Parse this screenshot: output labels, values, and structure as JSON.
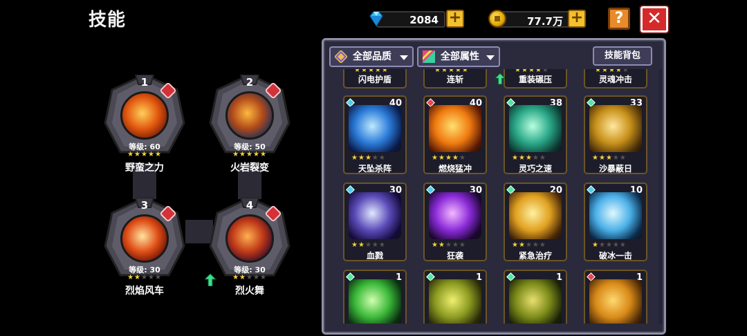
{
  "page": {
    "title": "技能"
  },
  "currency": {
    "gems": {
      "value": "2084",
      "icon": "diamond-gem-icon"
    },
    "gold": {
      "value": "77.7万",
      "icon": "gold-coin-icon"
    },
    "plus_label": "+"
  },
  "buttons": {
    "help_label": "?",
    "close_label": "✕"
  },
  "equipped": [
    {
      "slot": "1",
      "level": "等级: 60",
      "stars": 5,
      "name": "野蛮之力",
      "colors": [
        "#ffcf5a",
        "#e35a10",
        "#7a1a08"
      ]
    },
    {
      "slot": "2",
      "level": "等级: 50",
      "stars": 5,
      "name": "火岩裂变",
      "colors": [
        "#ffb840",
        "#b04a1a",
        "#1d2f5a"
      ]
    },
    {
      "slot": "3",
      "level": "等级: 30",
      "stars": 2,
      "name": "烈焰风车",
      "colors": [
        "#ffe3a0",
        "#e05018",
        "#6a1004"
      ]
    },
    {
      "slot": "4",
      "level": "等级: 30",
      "stars": 2,
      "name": "烈火舞",
      "colors": [
        "#ffb050",
        "#c03a18",
        "#3a0a2a"
      ]
    }
  ],
  "filters": {
    "quality_label": "全部品质",
    "attribute_label": "全部属性",
    "bag_label": "技能背包"
  },
  "top_row_partial": [
    {
      "name": "闪电护盾",
      "stars": 5,
      "upgrade": false
    },
    {
      "name": "连斩",
      "stars": 5,
      "upgrade": false
    },
    {
      "name": "重装碾压",
      "stars": 4,
      "upgrade": true
    },
    {
      "name": "灵魂冲击",
      "stars": 4,
      "upgrade": false
    }
  ],
  "skills": [
    {
      "name": "天坠杀阵",
      "count": "40",
      "stars": 3,
      "element": "#4fd0e8",
      "colors": [
        "#bfe9ff",
        "#2a7ad8",
        "#0a1a4a"
      ]
    },
    {
      "name": "燃烧猛冲",
      "count": "40",
      "stars": 4,
      "element": "#e8484f",
      "colors": [
        "#ffe070",
        "#f07a10",
        "#5a1a04"
      ]
    },
    {
      "name": "灵巧之速",
      "count": "38",
      "stars": 3,
      "element": "#4fe8a0",
      "colors": [
        "#b8ffe0",
        "#2aa888",
        "#0c3a30"
      ]
    },
    {
      "name": "沙暴蔽日",
      "count": "33",
      "stars": 3,
      "element": "#4fe8a0",
      "colors": [
        "#ffe8a0",
        "#c8901a",
        "#4a3008"
      ]
    },
    {
      "name": "血戮",
      "count": "30",
      "stars": 2,
      "element": "#4fd0e8",
      "colors": [
        "#e0e8ff",
        "#5a4ab8",
        "#140a3a"
      ]
    },
    {
      "name": "狂袭",
      "count": "30",
      "stars": 2,
      "element": "#4fd0e8",
      "colors": [
        "#f4b8ff",
        "#8a2ad8",
        "#1a0630"
      ]
    },
    {
      "name": "紧急治疗",
      "count": "20",
      "stars": 2,
      "element": "#4fe8a0",
      "colors": [
        "#fff0a0",
        "#e0a020",
        "#4a2808"
      ]
    },
    {
      "name": "破冰一击",
      "count": "10",
      "stars": 1,
      "element": "#4fd0e8",
      "colors": [
        "#e0f8ff",
        "#4ab0e8",
        "#0a2a4a"
      ]
    },
    {
      "name": "",
      "count": "1",
      "stars": 0,
      "element": "#4fe8a0",
      "colors": [
        "#d0ffb0",
        "#3ab838",
        "#0a3010"
      ]
    },
    {
      "name": "",
      "count": "1",
      "stars": 0,
      "element": "#4fe8a0",
      "colors": [
        "#f0f070",
        "#8a9a20",
        "#2a2a08"
      ]
    },
    {
      "name": "",
      "count": "1",
      "stars": 0,
      "element": "#4fe8a0",
      "colors": [
        "#e8e070",
        "#7a8a18",
        "#1a2008"
      ]
    },
    {
      "name": "",
      "count": "1",
      "stars": 0,
      "element": "#e8484f",
      "colors": [
        "#ffd870",
        "#d88a18",
        "#4a2806"
      ]
    }
  ],
  "colors": {
    "panel_bg": "#2b2a3c",
    "card_border": "#6b5526",
    "star": "#f5d23a",
    "close_red": "#d62a2a",
    "plus_gold": "#f2c12b"
  }
}
